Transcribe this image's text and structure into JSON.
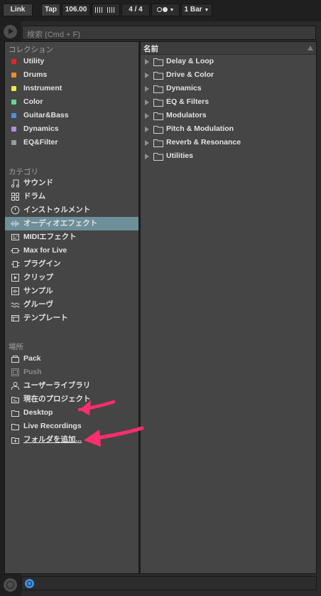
{
  "transport": {
    "link": "Link",
    "tap": "Tap",
    "tempo": "106.00",
    "time_sig": "4 / 4",
    "quantize": "1 Bar"
  },
  "search": {
    "placeholder": "検索 (Cmd + F)"
  },
  "collections": {
    "title": "コレクション",
    "items": [
      {
        "label": "Utility",
        "color": "#e52424"
      },
      {
        "label": "Drums",
        "color": "#f08b2a"
      },
      {
        "label": "Instrument",
        "color": "#f0e64a"
      },
      {
        "label": "Color",
        "color": "#5ddc8a"
      },
      {
        "label": "Guitar&Bass",
        "color": "#4a8fe0"
      },
      {
        "label": "Dynamics",
        "color": "#b48ae0"
      },
      {
        "label": "EQ&Filter",
        "color": "#9a9a9a"
      }
    ]
  },
  "categories": {
    "title": "カテゴリ",
    "items": [
      {
        "label": "サウンド",
        "icon": "note-icon"
      },
      {
        "label": "ドラム",
        "icon": "drum-grid-icon"
      },
      {
        "label": "インストゥルメント",
        "icon": "clock-icon"
      },
      {
        "label": "オーディオエフェクト",
        "icon": "waveform-icon",
        "selected": true
      },
      {
        "label": "MIDIエフェクト",
        "icon": "midi-icon"
      },
      {
        "label": "Max for Live",
        "icon": "max-icon"
      },
      {
        "label": "プラグイン",
        "icon": "plugin-icon"
      },
      {
        "label": "クリップ",
        "icon": "clip-icon"
      },
      {
        "label": "サンプル",
        "icon": "sample-icon"
      },
      {
        "label": "グルーヴ",
        "icon": "groove-icon"
      },
      {
        "label": "テンプレート",
        "icon": "template-icon"
      }
    ]
  },
  "places": {
    "title": "場所",
    "items": [
      {
        "label": "Pack",
        "icon": "pack-icon"
      },
      {
        "label": "Push",
        "icon": "push-icon",
        "dim": true
      },
      {
        "label": "ユーザーライブラリ",
        "icon": "user-icon"
      },
      {
        "label": "現在のプロジェクト",
        "icon": "project-icon"
      },
      {
        "label": "Desktop",
        "icon": "folder-icon"
      },
      {
        "label": "Live Recordings",
        "icon": "folder-icon"
      },
      {
        "label": "フォルダを追加...",
        "icon": "add-folder-icon",
        "link": true
      }
    ]
  },
  "content": {
    "column_header": "名前",
    "rows": [
      "Delay & Loop",
      "Drive & Color",
      "Dynamics",
      "EQ & Filters",
      "Modulators",
      "Pitch & Modulation",
      "Reverb & Resonance",
      "Utilities"
    ]
  },
  "colors": {
    "selection": "#6d8f9a",
    "annotation_arrow": "#ff2d6f"
  }
}
